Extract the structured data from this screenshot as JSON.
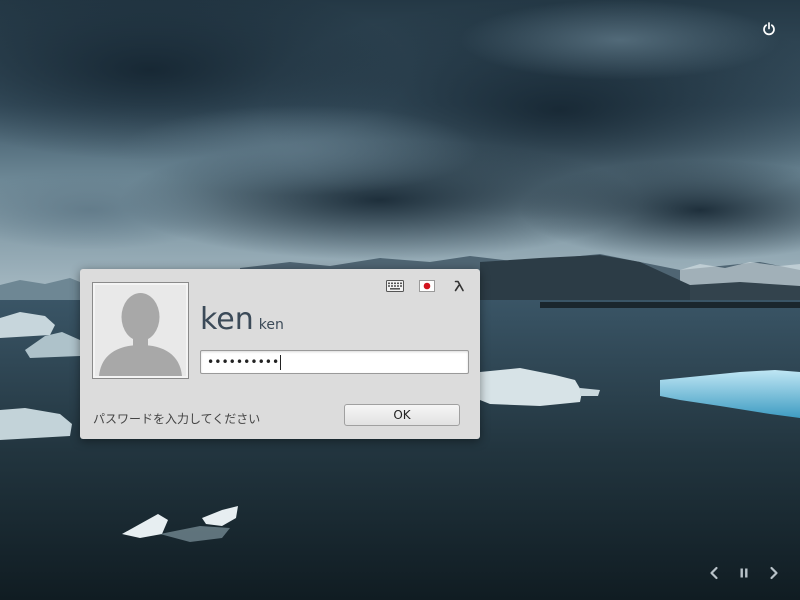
{
  "session": {
    "display_name": "ken",
    "username": "ken",
    "password_mask": "••••••••••",
    "prompt": "パスワードを入力してください",
    "ok_label": "OK"
  },
  "icons": {
    "power": "power-icon",
    "keyboard": "keyboard-icon",
    "input_method": "japan-flag-icon",
    "accessibility": "lambda-icon",
    "previous": "chevron-left-icon",
    "pause": "pause-icon",
    "next": "chevron-right-icon"
  },
  "colors": {
    "dialog_bg": "#dcdcdc",
    "name_text": "#3b4a58",
    "flag_red": "#d2141e"
  }
}
